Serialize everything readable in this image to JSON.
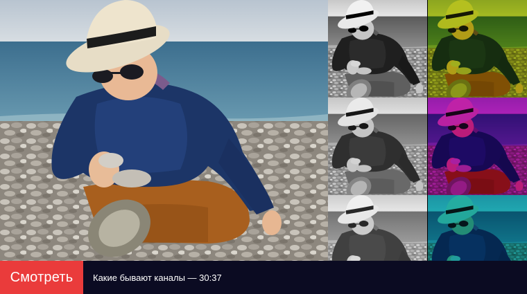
{
  "player": {
    "watch_label": "Смотреть",
    "caption": "Какие бывают каналы — 30:37"
  },
  "colors": {
    "watch_button": "#ea3b3b",
    "bar_background": "#0b0b22"
  },
  "thumbnails": [
    {
      "name": "thumb-grayscale-contrast",
      "tint": "none"
    },
    {
      "name": "thumb-yellow-green-channel",
      "tint": "#c8d800"
    },
    {
      "name": "thumb-grayscale-mid",
      "tint": "none"
    },
    {
      "name": "thumb-magenta-channel",
      "tint": "#c400c8"
    },
    {
      "name": "thumb-grayscale-light",
      "tint": "none"
    },
    {
      "name": "thumb-cyan-channel",
      "tint": "#00b0b8"
    }
  ]
}
